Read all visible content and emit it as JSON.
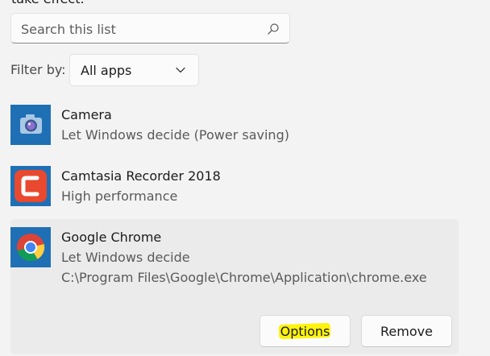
{
  "header": {
    "cutoff_text": "take effect."
  },
  "search": {
    "placeholder": "Search this list",
    "value": ""
  },
  "filter": {
    "label": "Filter by:",
    "selected": "All apps"
  },
  "apps": [
    {
      "name": "Camera",
      "setting": "Let Windows decide (Power saving)",
      "icon": "camera-icon",
      "color": "#1f6fb5"
    },
    {
      "name": "Camtasia Recorder 2018",
      "setting": "High performance",
      "icon": "camtasia-icon",
      "color": "#e8492f"
    },
    {
      "name": "Google Chrome",
      "setting": "Let Windows decide",
      "path": "C:\\Program Files\\Google\\Chrome\\Application\\chrome.exe",
      "icon": "chrome-icon",
      "color": "#1f6fb5"
    }
  ],
  "actions": {
    "options_label": "Options",
    "remove_label": "Remove"
  },
  "colors": {
    "background": "#f3f3f3",
    "card": "#ebebeb",
    "highlight": "#fff200"
  }
}
